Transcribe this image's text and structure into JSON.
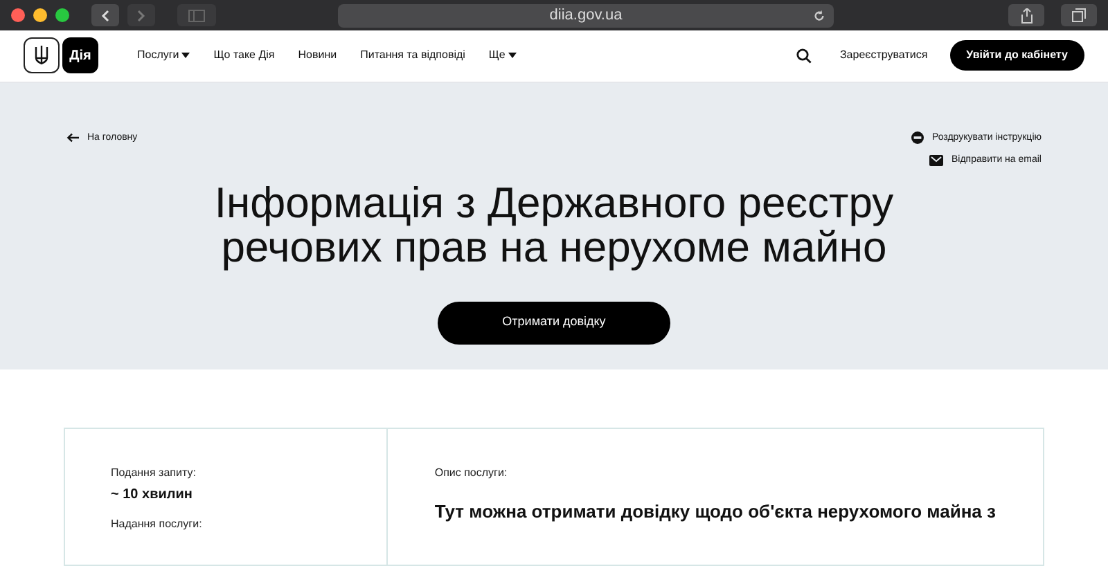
{
  "browser": {
    "url": "diia.gov.ua"
  },
  "header": {
    "logo_text": "Дія",
    "nav": [
      {
        "label": "Послуги",
        "dropdown": true
      },
      {
        "label": "Що таке Дія",
        "dropdown": false
      },
      {
        "label": "Новини",
        "dropdown": false
      },
      {
        "label": "Питання та відповіді",
        "dropdown": false
      },
      {
        "label": "Ще",
        "dropdown": true
      }
    ],
    "register": "Зареєструватися",
    "login": "Увійти до кабінету"
  },
  "hero": {
    "back": "На головну",
    "actions": [
      {
        "kind": "print",
        "label": "Роздрукувати інструкцію"
      },
      {
        "kind": "email",
        "label": "Відправити на email"
      }
    ],
    "title": "Інформація з Державного реєстру речових прав на нерухоме майно",
    "button": "Отримати довідку"
  },
  "info": {
    "left": [
      {
        "label": "Подання запиту:",
        "value": "~ 10 хвилин"
      },
      {
        "label": "Надання послуги:"
      }
    ],
    "description_label": "Опис послуги:",
    "description": "Тут можна отримати довідку щодо об'єкта нерухомого майна з"
  }
}
